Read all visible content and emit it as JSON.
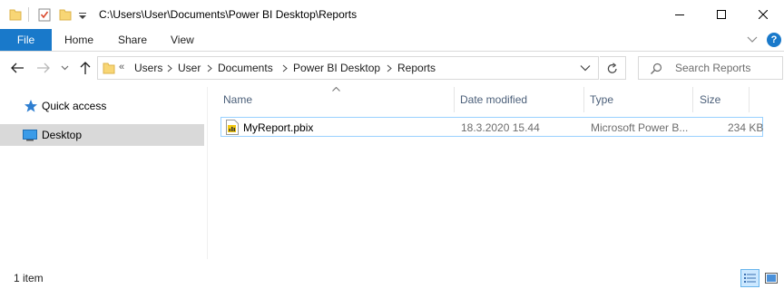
{
  "window": {
    "path_title": "C:\\Users\\User\\Documents\\Power BI Desktop\\Reports",
    "controls": [
      "minimize-icon",
      "maximize-icon",
      "close-icon"
    ]
  },
  "quick_access_toolbar": {
    "icons": [
      "folder-icon",
      "properties-icon",
      "new-folder-icon",
      "customize-dropdown-icon"
    ]
  },
  "ribbon": {
    "tabs": [
      {
        "label": "File"
      },
      {
        "label": "Home"
      },
      {
        "label": "Share"
      },
      {
        "label": "View"
      }
    ],
    "help_label": "?"
  },
  "address": {
    "overflow": "«",
    "crumbs": [
      "Users",
      "User",
      "Documents",
      "Power BI Desktop",
      "Reports"
    ]
  },
  "search": {
    "placeholder": "Search Reports"
  },
  "nav_pane": {
    "items": [
      {
        "label": "Quick access",
        "icon": "star-icon"
      },
      {
        "label": "Desktop",
        "icon": "desktop-icon",
        "selected": true
      }
    ]
  },
  "file_list": {
    "columns": [
      "Name",
      "Date modified",
      "Type",
      "Size"
    ],
    "rows": [
      {
        "name": "MyReport.pbix",
        "date_modified": "18.3.2020 15.44",
        "type": "Microsoft Power B...",
        "size": "234 KB"
      }
    ]
  },
  "status_bar": {
    "item_count": "1 item"
  },
  "colors": {
    "accent": "#1979ca",
    "selection_border": "#99d1ff",
    "nav_selected": "#d9d9d9",
    "header_text": "#4c607a"
  }
}
